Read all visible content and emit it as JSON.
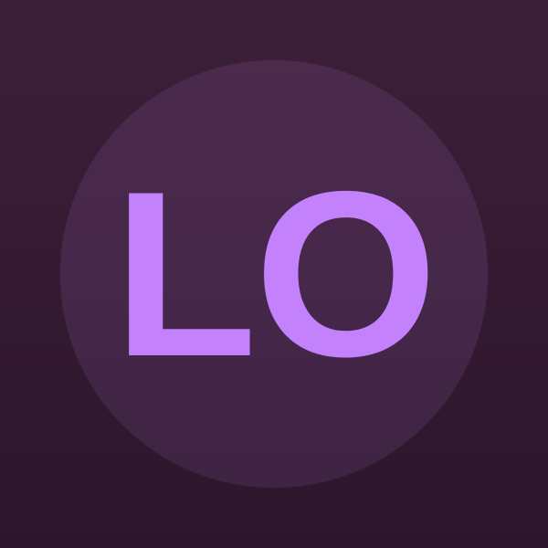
{
  "avatar": {
    "initials": "LO"
  },
  "colors": {
    "background": "#351c33",
    "circle": "#472849",
    "initials": "#c381fb"
  }
}
